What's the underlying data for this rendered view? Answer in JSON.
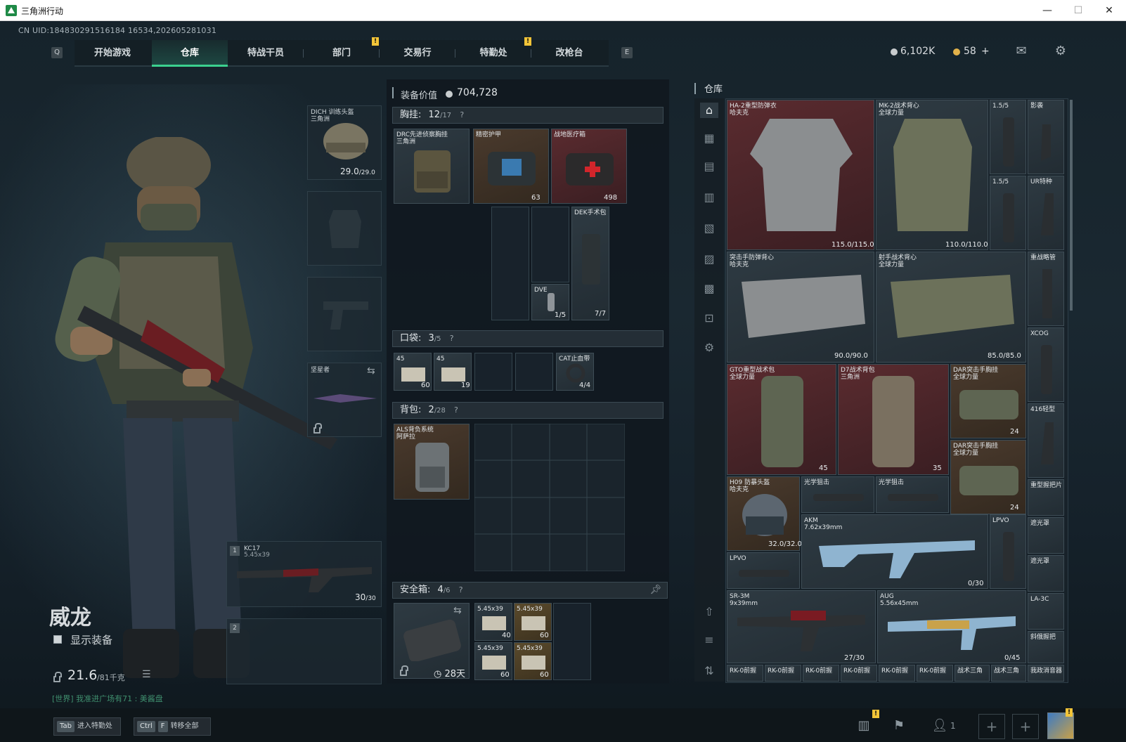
{
  "window": {
    "title": "三角洲行动",
    "minimize": "—",
    "maximize": "☐",
    "close": "✕"
  },
  "uid": "CN UID:184830291516184 16534,202605281031",
  "nav": {
    "left_key": "Q",
    "right_key": "E",
    "tabs": [
      "开始游戏",
      "仓库",
      "特战干员",
      "部门",
      "交易行",
      "特勤处",
      "改枪台"
    ],
    "active_tab": "仓库"
  },
  "currency": {
    "coins": "6,102K",
    "tokens": "58",
    "plus": "+"
  },
  "loadout": {
    "helmet": {
      "name": "DICH 训练头盔",
      "sub": "三角洲",
      "durability": "29.0",
      "max": "/29.0"
    },
    "melee": {
      "name": "坚星者"
    },
    "primary": {
      "slot": "1",
      "name": "KC17",
      "caliber": "5.45x39",
      "ammo": "30",
      "ammo_max": "/30"
    },
    "secondary": {
      "slot": "2"
    }
  },
  "operator": {
    "name": "威龙",
    "show_gear": "显示装备",
    "weight": "21.6",
    "weight_max": "/81千克",
    "chat": "[世界] 我准进广场有71 : 美酱盘"
  },
  "equipment": {
    "value_label": "装备价值",
    "value": "704,728",
    "rig": {
      "label": "胸挂:",
      "count": "12",
      "max": "/17"
    },
    "pockets": {
      "label": "口袋:",
      "count": "3",
      "max": "/5"
    },
    "backpack": {
      "label": "背包:",
      "count": "2",
      "max": "/28"
    },
    "safebox": {
      "label": "安全箱:",
      "count": "4",
      "max": "/6",
      "days": "28天"
    },
    "rig_items": [
      {
        "name": "DRC先进侦察胸挂",
        "sub": "三角洲"
      },
      {
        "name": "精密护甲",
        "count": "63"
      },
      {
        "name": "战地医疗箱",
        "count": "498"
      },
      {
        "name": "DEK手术包",
        "count": "7/7"
      },
      {
        "name": "DVE",
        "count": "1/5"
      }
    ],
    "pocket_items": [
      {
        "name": "45",
        "count": "60"
      },
      {
        "name": "45",
        "count": "19"
      },
      {
        "name": "CAT止血带",
        "count": "4/4"
      }
    ],
    "backpack_item": {
      "name": "ALS背负系统",
      "sub": "阿萨拉"
    },
    "safebox_items": [
      {
        "name": "5.45x39",
        "count": "40"
      },
      {
        "name": "5.45x39",
        "count": "60"
      },
      {
        "name": "5.45x39",
        "count": "60"
      },
      {
        "name": "5.45x39",
        "count": "60"
      }
    ]
  },
  "stash": {
    "title": "仓库",
    "items": [
      {
        "name": "HA-2重型防弹衣",
        "sub": "哈夫克",
        "value": "115.0/115.0"
      },
      {
        "name": "MK-2战术背心",
        "sub": "全球力量",
        "value": "110.0/110.0"
      },
      {
        "name": "1.5/5"
      },
      {
        "name": "影袭"
      },
      {
        "name": "1.5/5"
      },
      {
        "name": "UR特种"
      },
      {
        "name": "突击手防弹背心",
        "sub": "哈夫克",
        "value": "90.0/90.0"
      },
      {
        "name": "射手战术背心",
        "sub": "全球力量",
        "value": "85.0/85.0"
      },
      {
        "name": "重战略管"
      },
      {
        "name": "XCOG"
      },
      {
        "name": "GTO重型战术包",
        "sub": "全球力量",
        "count": "45"
      },
      {
        "name": "D7战术背包",
        "sub": "三角洲",
        "count": "35"
      },
      {
        "name": "DAR突击手胸挂",
        "sub": "全球力量",
        "count": "24"
      },
      {
        "name": "416轻型"
      },
      {
        "name": "DAR突击手胸挂",
        "sub": "全球力量",
        "count": "24"
      },
      {
        "name": "重型握把片"
      },
      {
        "name": "H09 防暴头盔",
        "sub": "哈夫克",
        "value": "32.0/32.0"
      },
      {
        "name": "光学狙击"
      },
      {
        "name": "光学狙击"
      },
      {
        "name": "AKM",
        "sub": "7.62x39mm",
        "count": "0/30"
      },
      {
        "name": "LPVO"
      },
      {
        "name": "遮光罩"
      },
      {
        "name": "LPVO"
      },
      {
        "name": "遮光罩"
      },
      {
        "name": "SR-3M",
        "sub": "9x39mm",
        "count": "27/30"
      },
      {
        "name": "AUG",
        "sub": "5.56x45mm",
        "count": "0/45"
      },
      {
        "name": "LA-3C"
      },
      {
        "name": "斜俄握把"
      }
    ],
    "bottom_row": [
      "RK-0前握",
      "RK-0前握",
      "RK-0前握",
      "RK-0前握",
      "RK-0前握",
      "RK-0前握",
      "战术三角",
      "战术三角",
      "我政消音器"
    ]
  },
  "bottom": {
    "tab_key": "Tab",
    "tab_label": "进入特勤处",
    "ctrl_key": "Ctrl",
    "f_key": "F",
    "f_label": "转移全部",
    "friends": "1"
  },
  "colors": {
    "accent": "#3bd18f",
    "badge": "#f2c438",
    "stash_red": "#5a2b2f",
    "stash_brown": "#4a3a2d"
  }
}
